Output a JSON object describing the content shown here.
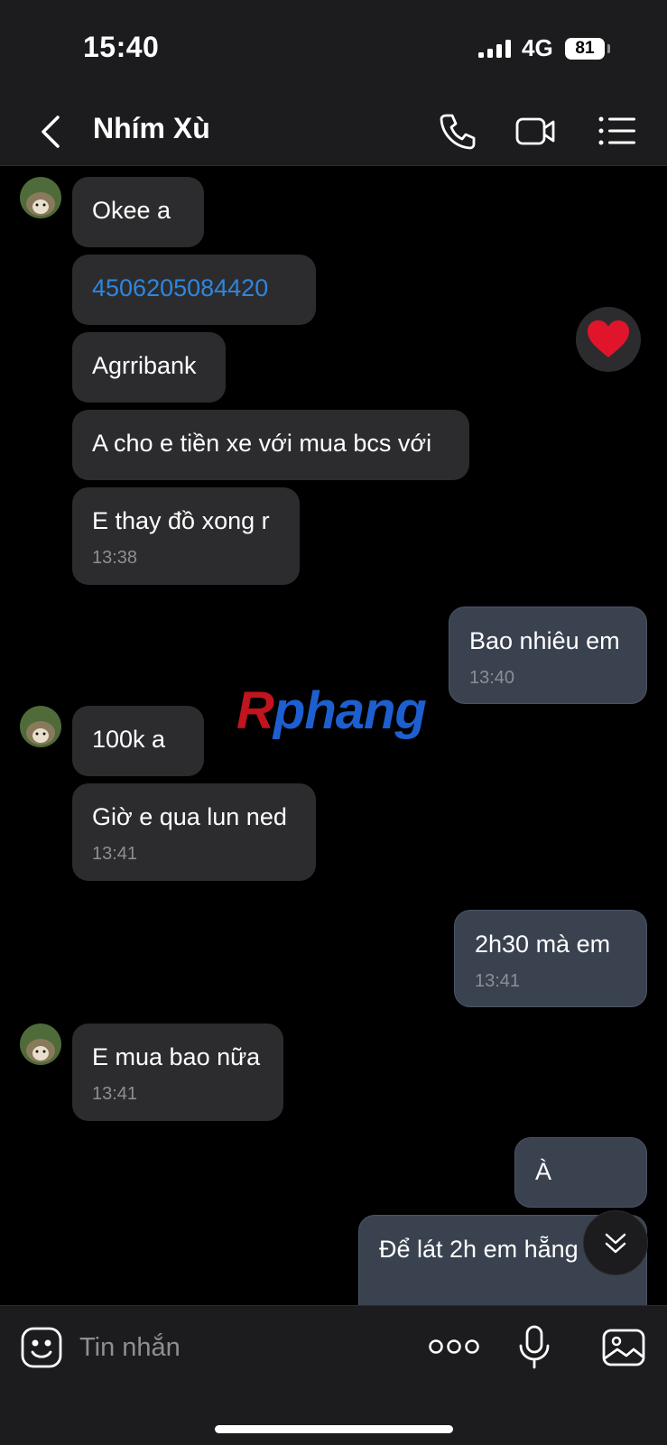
{
  "status_bar": {
    "time": "15:40",
    "network": "4G",
    "battery": "81"
  },
  "header": {
    "title": "Nhím Xù",
    "icons": [
      "back-icon",
      "phone-icon",
      "video-call-icon",
      "menu-list-icon"
    ]
  },
  "messages": [
    {
      "text": "Okee a",
      "direction": "in"
    },
    {
      "text": "4506205084420",
      "direction": "in",
      "link": true
    },
    {
      "text": "Agrribank",
      "direction": "in",
      "reaction": "heart"
    },
    {
      "text": "A cho e tiền xe với mua bcs với",
      "direction": "in"
    },
    {
      "text": "E thay đồ xong r",
      "time": "13:38",
      "direction": "in"
    },
    {
      "text": "Bao nhiêu em",
      "time": "13:40",
      "direction": "out"
    },
    {
      "text": "100k a",
      "direction": "in"
    },
    {
      "text": "Giờ e qua lun ned",
      "time": "13:41",
      "direction": "in"
    },
    {
      "text": "2h30 mà em",
      "time": "13:41",
      "direction": "out"
    },
    {
      "text": "E mua bao nữa",
      "time": "13:41",
      "direction": "in"
    },
    {
      "text": "À",
      "direction": "out"
    },
    {
      "text": "Để lát 2h em hẵng",
      "direction": "out"
    }
  ],
  "watermark": {
    "first_letter": "R",
    "rest": "phang"
  },
  "composer": {
    "placeholder": "Tin nhắn"
  },
  "colors": {
    "incoming_bubble": "#2c2c2e",
    "outgoing_bubble": "#3a4250",
    "link": "#2e86de",
    "background": "#000000"
  }
}
